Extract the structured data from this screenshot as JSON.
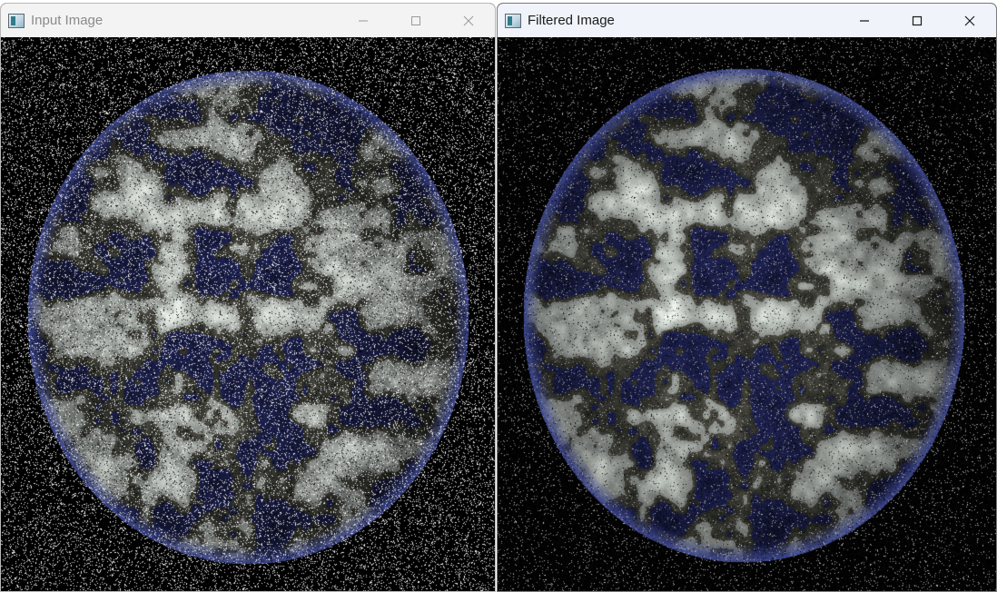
{
  "windows": {
    "input": {
      "title": "Input Image",
      "minimize_icon": "minimize-icon",
      "maximize_icon": "maximize-icon",
      "close_icon": "close-icon",
      "image": "noisy-earth-image"
    },
    "filtered": {
      "title": "Filtered Image",
      "minimize_icon": "minimize-icon",
      "maximize_icon": "maximize-icon",
      "close_icon": "close-icon",
      "image": "filtered-earth-image"
    }
  },
  "colors": {
    "titlebar_inactive": "#f3f3f3",
    "titlebar_active": "#f0f3f9",
    "inactive_text": "#8a8a8a",
    "active_text": "#1b1b1b",
    "image_background": "#000000"
  }
}
